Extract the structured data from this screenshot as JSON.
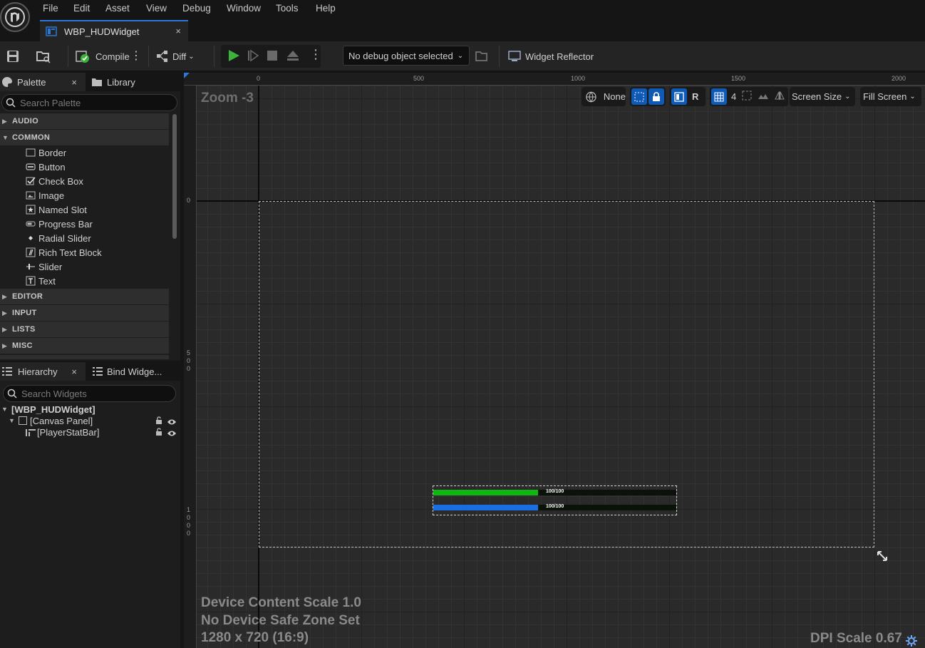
{
  "menu": {
    "items": [
      "File",
      "Edit",
      "Asset",
      "View",
      "Debug",
      "Window",
      "Tools",
      "Help"
    ]
  },
  "tab": {
    "title": "WBP_HUDWidget",
    "close": "×"
  },
  "toolbar": {
    "compile_label": "Compile",
    "diff_label": "Diff",
    "debug_select": "No debug object selected",
    "widget_reflector_label": "Widget Reflector"
  },
  "palette": {
    "tab_label": "Palette",
    "tab_close": "×",
    "library_tab_label": "Library",
    "search_placeholder": "Search Palette",
    "categories": {
      "audio": "AUDIO",
      "common": "COMMON",
      "editor": "EDITOR",
      "input": "INPUT",
      "lists": "LISTS",
      "misc": "MISC"
    },
    "common_items": [
      "Border",
      "Button",
      "Check Box",
      "Image",
      "Named Slot",
      "Progress Bar",
      "Radial Slider",
      "Rich Text Block",
      "Slider",
      "Text"
    ]
  },
  "hierarchy": {
    "tab_label": "Hierarchy",
    "tab_close": "×",
    "bind_tab_label": "Bind Widge...",
    "search_placeholder": "Search Widgets",
    "root": "[WBP_HUDWidget]",
    "canvas": "[Canvas Panel]",
    "child": "[PlayerStatBar]"
  },
  "viewport": {
    "zoom": "Zoom -3",
    "localization": "None",
    "r_label": "R",
    "grid_value": "4",
    "screen_size": "Screen Size",
    "fill_screen": "Fill Screen",
    "ruler_top": [
      "0",
      "500",
      "1000",
      "1500",
      "2000"
    ],
    "ruler_left": [
      "0",
      "5",
      "0",
      "0",
      "1",
      "0",
      "0",
      "0"
    ],
    "health_text": "100/100",
    "mana_text": "100/100",
    "health_fill": 0.43,
    "mana_fill": 0.43,
    "device_scale": "Device Content Scale 1.0",
    "safe_zone": "No Device Safe Zone Set",
    "resolution": "1280 x 720 (16:9)",
    "dpi_scale": "DPI Scale 0.67"
  },
  "colors": {
    "health": "#11b711",
    "mana": "#1a6fe0",
    "accent": "#0f5ab4"
  }
}
